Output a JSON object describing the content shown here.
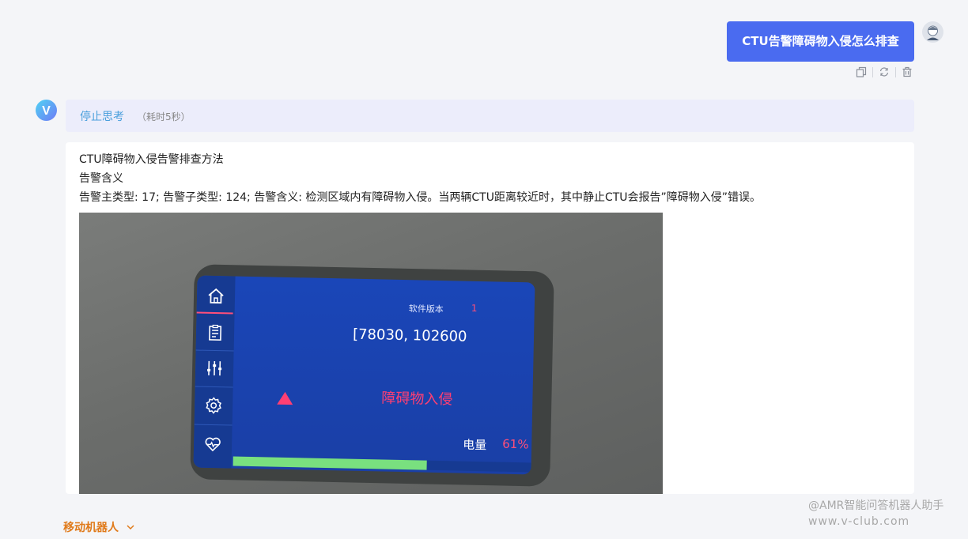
{
  "user_message": {
    "text": "CTU告警障碍物入侵怎么排查"
  },
  "message_tools": [
    "copy-icon",
    "refresh-icon",
    "delete-icon"
  ],
  "bot": {
    "avatar_letter": "V",
    "thinking": {
      "title": "停止思考",
      "time": "（耗时5秒）"
    },
    "answer": {
      "line1": "CTU障碍物入侵告警排查方法",
      "line2": "告警含义",
      "line3": "告警主类型: 17; 告警子类型: 124; 告警含义: 检测区域内有障碍物入侵。当两辆CTU距离较近时，其中静止CTU会报告”障碍物入侵”错误。"
    }
  },
  "device_screen": {
    "version_label": "软件版本",
    "version_value": "1",
    "code": "[78030, 102600",
    "warning": "障碍物入侵",
    "battery_label": "电量",
    "battery_value": "61%",
    "progress_fraction": 0.65,
    "side_icons": [
      "home-icon",
      "clipboard-icon",
      "sliders-icon",
      "settings-icon",
      "heart-pulse-icon"
    ]
  },
  "footer": {
    "category": "移动机器人",
    "watermark_line1": "@AMR智能问答机器人助手",
    "watermark_line2": "www.v-club.com"
  },
  "colors": {
    "accent": "#4a6bf0",
    "thinking_bg": "#ecedfb",
    "thinking_text": "#4a9fdc",
    "warning": "#ff3f73",
    "category": "#e07a1a"
  }
}
